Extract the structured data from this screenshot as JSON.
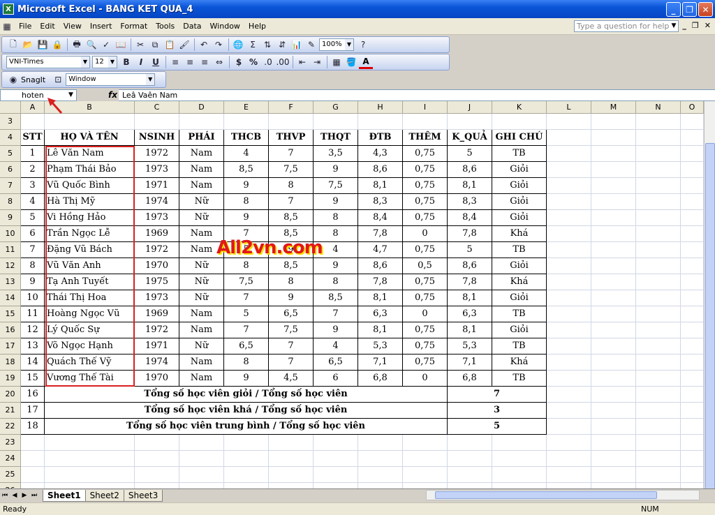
{
  "window": {
    "title": "Microsoft Excel - BANG KET QUA_4",
    "app_icon": "X"
  },
  "menu": {
    "items": [
      "File",
      "Edit",
      "View",
      "Insert",
      "Format",
      "Tools",
      "Data",
      "Window",
      "Help"
    ],
    "help_placeholder": "Type a question for help"
  },
  "toolbar": {
    "zoom": "100%",
    "font": "VNI-Times",
    "size": "12",
    "snagit": "SnagIt",
    "snagit_target": "Window",
    "bold": "B",
    "italic": "I",
    "underline": "U",
    "currency": "$",
    "percent": "%",
    "font_color": "A"
  },
  "formula_bar": {
    "name_box": "hoten",
    "fx": "fx",
    "content": "Leâ Vaên Nam"
  },
  "columns": [
    "A",
    "B",
    "C",
    "D",
    "E",
    "F",
    "G",
    "H",
    "I",
    "J",
    "K",
    "L",
    "M",
    "N",
    "O"
  ],
  "header_row": [
    "STT",
    "HỌ VÀ TÊN",
    "NSINH",
    "PHÁI",
    "THCB",
    "THVP",
    "THQT",
    "ĐTB",
    "THÊM",
    "K_QUẢ",
    "GHI CHÚ"
  ],
  "rows": [
    [
      "1",
      "Lê Văn Nam",
      "1972",
      "Nam",
      "4",
      "7",
      "3,5",
      "4,3",
      "0,75",
      "5",
      "TB"
    ],
    [
      "2",
      "Phạm Thái Bảo",
      "1973",
      "Nam",
      "8,5",
      "7,5",
      "9",
      "8,6",
      "0,75",
      "8,6",
      "Giỏi"
    ],
    [
      "3",
      "Vũ Quốc Bình",
      "1971",
      "Nam",
      "9",
      "8",
      "7,5",
      "8,1",
      "0,75",
      "8,1",
      "Giỏi"
    ],
    [
      "4",
      "Hà Thị Mỹ",
      "1974",
      "Nữ",
      "8",
      "7",
      "9",
      "8,3",
      "0,75",
      "8,3",
      "Giỏi"
    ],
    [
      "5",
      "Vi Hồng Hảo",
      "1973",
      "Nữ",
      "9",
      "8,5",
      "8",
      "8,4",
      "0,75",
      "8,4",
      "Giỏi"
    ],
    [
      "6",
      "Trần Ngọc Lễ",
      "1969",
      "Nam",
      "7",
      "8,5",
      "8",
      "7,8",
      "0",
      "7,8",
      "Khá"
    ],
    [
      "7",
      "Đặng Vũ Bách",
      "1972",
      "Nam",
      "5",
      "9",
      "4",
      "4,7",
      "0,75",
      "5",
      "TB"
    ],
    [
      "8",
      "Vũ Văn Anh",
      "1970",
      "Nữ",
      "8",
      "8,5",
      "9",
      "8,6",
      "0,5",
      "8,6",
      "Giỏi"
    ],
    [
      "9",
      "Tạ Anh Tuyết",
      "1975",
      "Nữ",
      "7,5",
      "8",
      "8",
      "7,8",
      "0,75",
      "7,8",
      "Khá"
    ],
    [
      "10",
      "Thái Thị Hoa",
      "1973",
      "Nữ",
      "7",
      "9",
      "8,5",
      "8,1",
      "0,75",
      "8,1",
      "Giỏi"
    ],
    [
      "11",
      "Hoàng Ngọc Vũ",
      "1969",
      "Nam",
      "5",
      "6,5",
      "7",
      "6,3",
      "0",
      "6,3",
      "TB"
    ],
    [
      "12",
      "Lý Quốc Sự",
      "1972",
      "Nam",
      "7",
      "7,5",
      "9",
      "8,1",
      "0,75",
      "8,1",
      "Giỏi"
    ],
    [
      "13",
      "Võ Ngọc Hạnh",
      "1971",
      "Nữ",
      "6,5",
      "7",
      "4",
      "5,3",
      "0,75",
      "5,3",
      "TB"
    ],
    [
      "14",
      "Quách Thế Vỹ",
      "1974",
      "Nam",
      "8",
      "7",
      "6,5",
      "7,1",
      "0,75",
      "7,1",
      "Khá"
    ],
    [
      "15",
      "Vương Thế Tài",
      "1970",
      "Nam",
      "9",
      "4,5",
      "6",
      "6,8",
      "0",
      "6,8",
      "TB"
    ]
  ],
  "summary": [
    {
      "stt": "16",
      "label": "Tổng số học viên giỏi / Tổng số học viên",
      "value": "7"
    },
    {
      "stt": "17",
      "label": "Tổng số học viên khá / Tổng số học viên",
      "value": "3"
    },
    {
      "stt": "18",
      "label": "Tổng số học viên trung bình / Tổng số học viên",
      "value": "5"
    }
  ],
  "row_numbers": [
    "3",
    "4",
    "5",
    "6",
    "7",
    "8",
    "9",
    "10",
    "11",
    "12",
    "13",
    "14",
    "15",
    "16",
    "17",
    "18",
    "19",
    "20",
    "21",
    "22",
    "23",
    "24",
    "25",
    "26"
  ],
  "watermark": "All2vn.com",
  "sheets": [
    "Sheet1",
    "Sheet2",
    "Sheet3"
  ],
  "status": {
    "left": "Ready",
    "num": "NUM"
  },
  "colors": {
    "title_blue": "#0a55d8",
    "selection_red": "#d82020",
    "watermark_red": "#e01818"
  }
}
